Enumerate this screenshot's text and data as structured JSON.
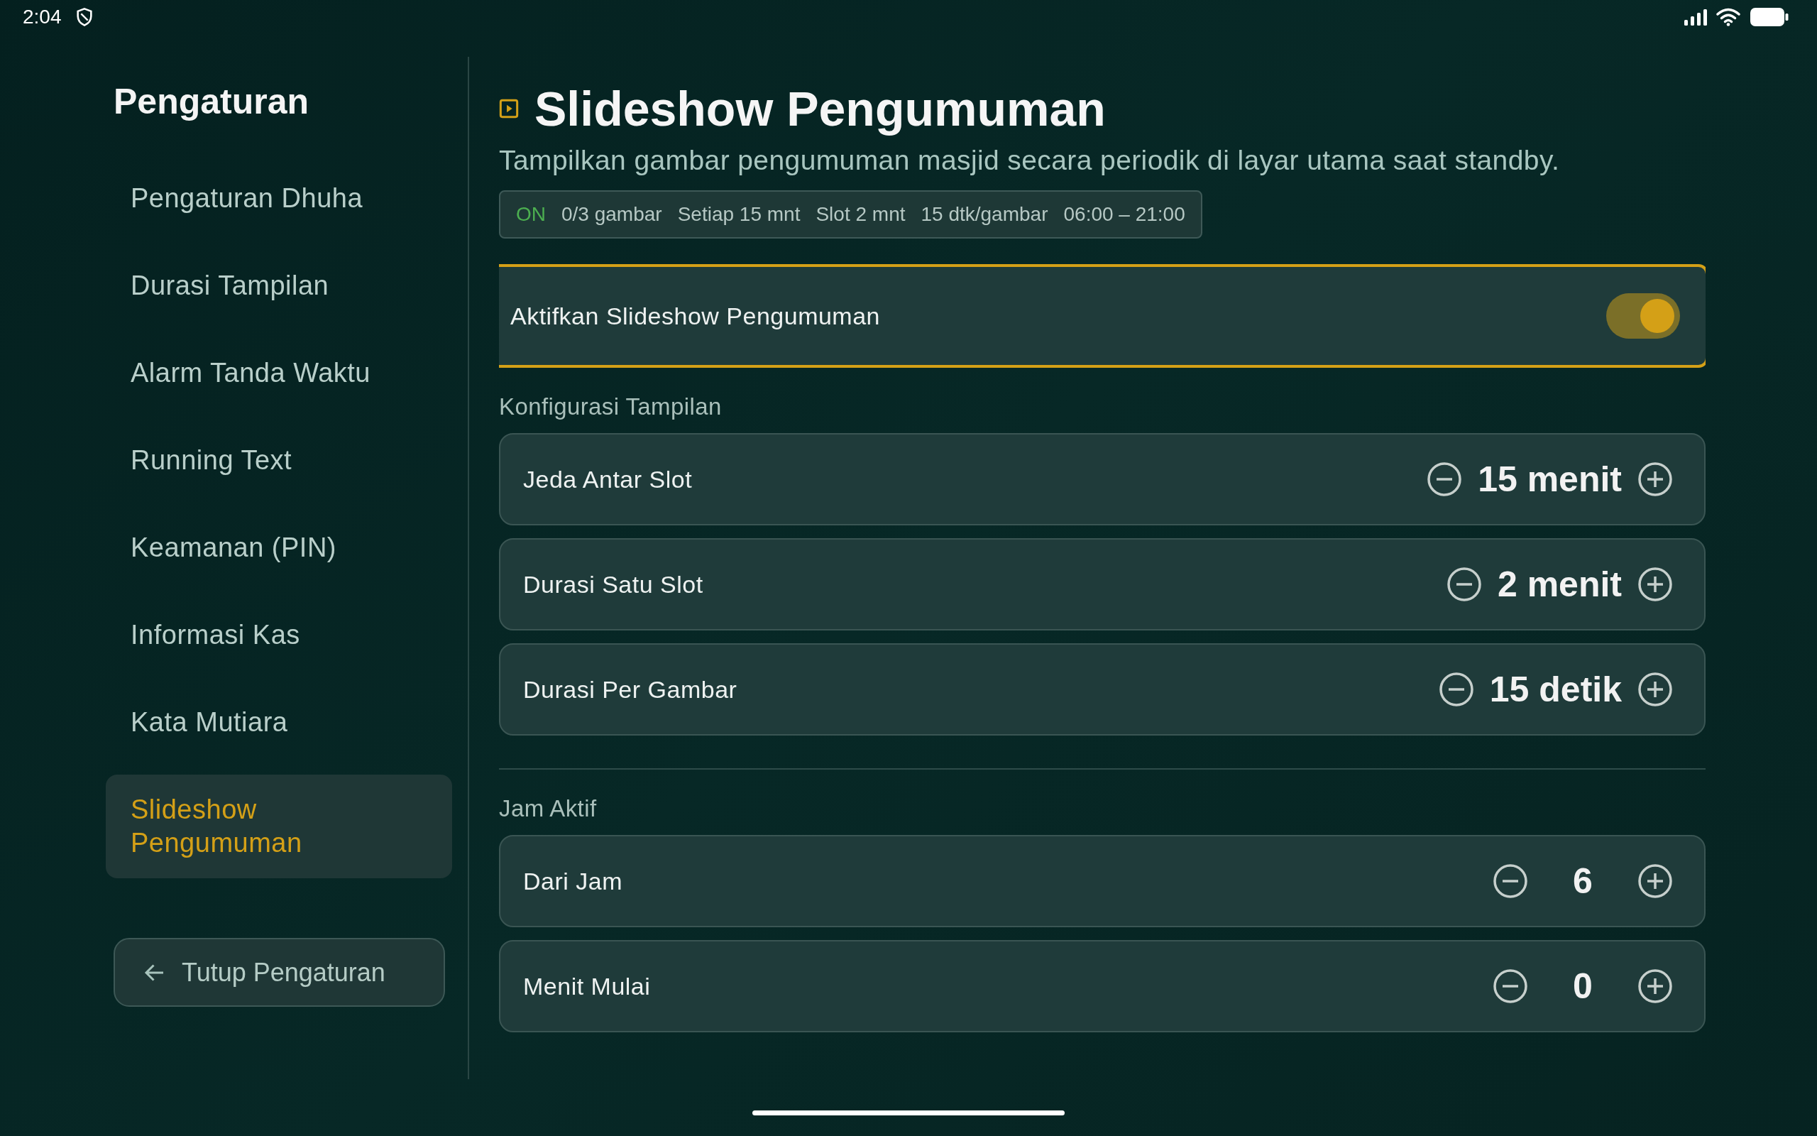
{
  "status_bar": {
    "time": "2:04"
  },
  "sidebar": {
    "title": "Pengaturan",
    "items": [
      {
        "label": "Pengaturan Dhuha",
        "selected": false
      },
      {
        "label": "Durasi Tampilan",
        "selected": false
      },
      {
        "label": "Alarm Tanda Waktu",
        "selected": false
      },
      {
        "label": "Running Text",
        "selected": false
      },
      {
        "label": "Keamanan (PIN)",
        "selected": false
      },
      {
        "label": "Informasi Kas",
        "selected": false
      },
      {
        "label": "Kata Mutiara",
        "selected": false
      },
      {
        "label": "Slideshow Pengumuman",
        "selected": true
      }
    ],
    "close_button": "Tutup Pengaturan"
  },
  "header": {
    "title": "Slideshow Pengumuman",
    "subtitle": "Tampilkan gambar pengumuman masjid secara periodik di layar utama saat standby."
  },
  "summary": {
    "status": "ON",
    "on": true,
    "parts": [
      "0/3 gambar",
      "Setiap 15 mnt",
      "Slot 2 mnt",
      "15 dtk/gambar",
      "06:00 – 21:00"
    ]
  },
  "toggle": {
    "label": "Aktifkan Slideshow Pengumuman",
    "on": true
  },
  "sections": [
    {
      "title": "Konfigurasi Tampilan",
      "rows": [
        {
          "label": "Jeda Antar Slot",
          "value": "15 menit"
        },
        {
          "label": "Durasi Satu Slot",
          "value": "2 menit"
        },
        {
          "label": "Durasi Per Gambar",
          "value": "15 detik"
        }
      ]
    },
    {
      "title": "Jam Aktif",
      "rows": [
        {
          "label": "Dari Jam",
          "value": "6"
        },
        {
          "label": "Menit Mulai",
          "value": "0"
        }
      ]
    }
  ]
}
